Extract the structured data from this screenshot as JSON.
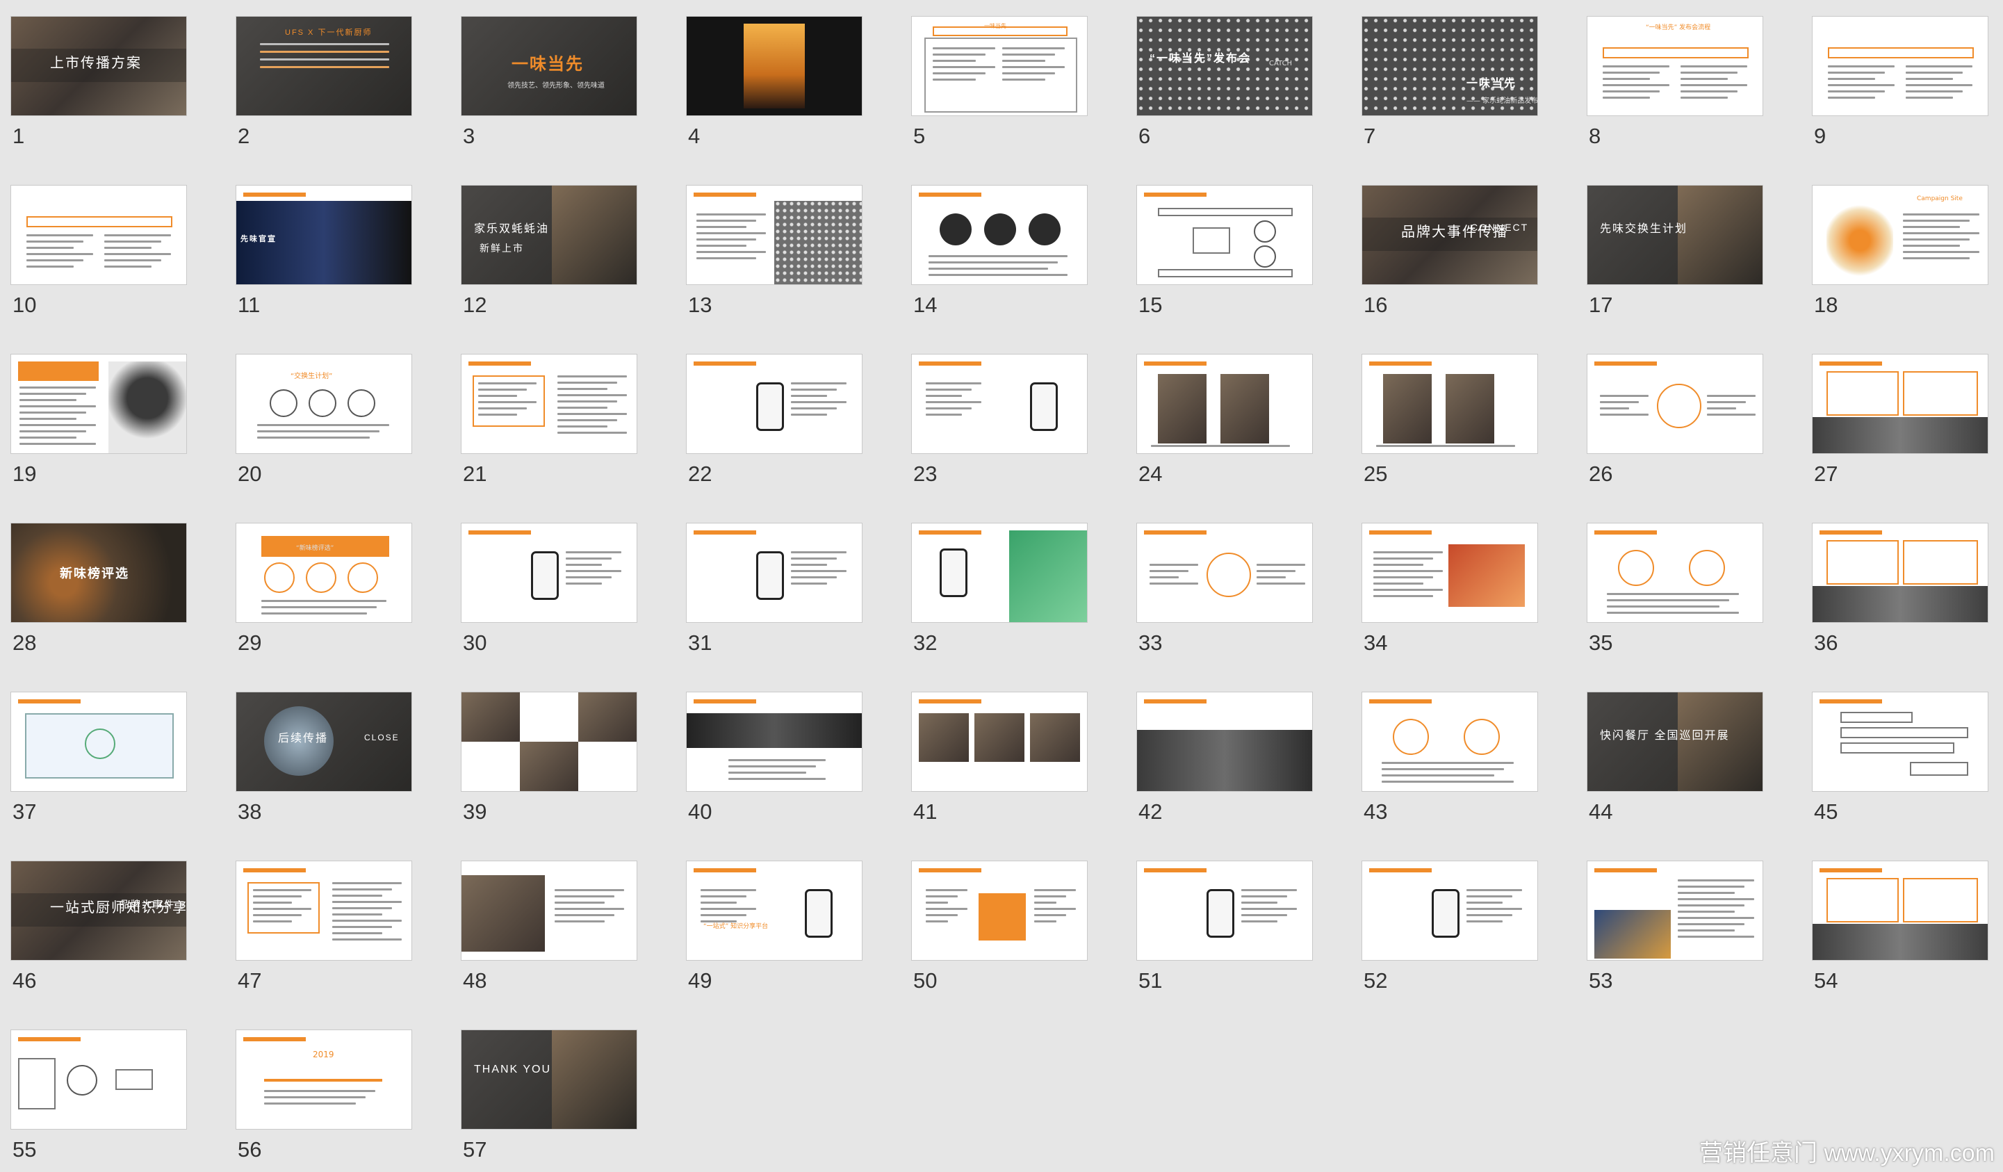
{
  "app": {
    "view": "slide-sorter"
  },
  "colors": {
    "accent": "#f08c2a",
    "background": "#e6e6e6"
  },
  "slides": [
    {
      "number": "1",
      "title": "上市传播方案"
    },
    {
      "number": "2",
      "title": "UFS X 下一代新厨师"
    },
    {
      "number": "3",
      "title": "一味当先",
      "subtitle": "领先技艺、领先形象、领先味道"
    },
    {
      "number": "4",
      "title": ""
    },
    {
      "number": "5",
      "title": "一味当先"
    },
    {
      "number": "6",
      "title": "“一味当先”发布会",
      "subtitle": "CATCH"
    },
    {
      "number": "7",
      "title": "一味当先",
      "subtitle": "—— 家乐蚝油新品发布会"
    },
    {
      "number": "8",
      "title": "“一味当先” 发布会流程"
    },
    {
      "number": "9",
      "title": ""
    },
    {
      "number": "10",
      "title": ""
    },
    {
      "number": "11",
      "title": "先味官宣"
    },
    {
      "number": "12",
      "title": "家乐双蚝蚝油",
      "subtitle": "新鲜上市"
    },
    {
      "number": "13",
      "title": ""
    },
    {
      "number": "14",
      "title": ""
    },
    {
      "number": "15",
      "title": ""
    },
    {
      "number": "16",
      "title": "品牌大事件传播",
      "subtitle": "CONNECT"
    },
    {
      "number": "17",
      "title": "先味交换生计划"
    },
    {
      "number": "18",
      "title": "Campaign Site"
    },
    {
      "number": "19",
      "title": ""
    },
    {
      "number": "20",
      "title": "“交换生计划”"
    },
    {
      "number": "21",
      "title": ""
    },
    {
      "number": "22",
      "title": ""
    },
    {
      "number": "23",
      "title": ""
    },
    {
      "number": "24",
      "title": ""
    },
    {
      "number": "25",
      "title": ""
    },
    {
      "number": "26",
      "title": ""
    },
    {
      "number": "27",
      "title": ""
    },
    {
      "number": "28",
      "title": "新味榜评选"
    },
    {
      "number": "29",
      "title": "“新味榜评选”"
    },
    {
      "number": "30",
      "title": ""
    },
    {
      "number": "31",
      "title": ""
    },
    {
      "number": "32",
      "title": ""
    },
    {
      "number": "33",
      "title": ""
    },
    {
      "number": "34",
      "title": ""
    },
    {
      "number": "35",
      "title": ""
    },
    {
      "number": "36",
      "title": ""
    },
    {
      "number": "37",
      "title": ""
    },
    {
      "number": "38",
      "title": "后续传播",
      "subtitle": "CLOSE"
    },
    {
      "number": "39",
      "title": ""
    },
    {
      "number": "40",
      "title": ""
    },
    {
      "number": "41",
      "title": ""
    },
    {
      "number": "42",
      "title": ""
    },
    {
      "number": "43",
      "title": ""
    },
    {
      "number": "44",
      "title": "快闪餐厅 全国巡回开展"
    },
    {
      "number": "45",
      "title": ""
    },
    {
      "number": "46",
      "title": "一站式厨师知识分享平台",
      "subtitle": "品牌大事件 BACK UP"
    },
    {
      "number": "47",
      "title": ""
    },
    {
      "number": "48",
      "title": ""
    },
    {
      "number": "49",
      "title": "“一站式” 知识分享平台"
    },
    {
      "number": "50",
      "title": ""
    },
    {
      "number": "51",
      "title": ""
    },
    {
      "number": "52",
      "title": ""
    },
    {
      "number": "53",
      "title": ""
    },
    {
      "number": "54",
      "title": ""
    },
    {
      "number": "55",
      "title": ""
    },
    {
      "number": "56",
      "title": "2019"
    },
    {
      "number": "57",
      "title": "THANK YOU"
    }
  ],
  "watermark": "营销任意门 www.yxrym.com"
}
